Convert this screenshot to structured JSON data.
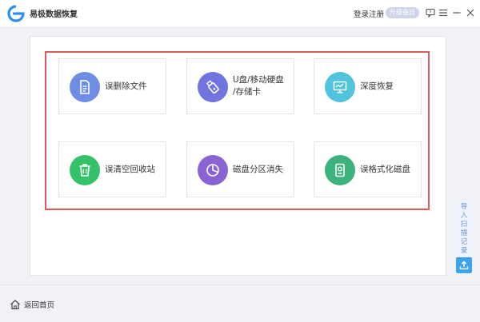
{
  "app": {
    "title": "易极数据恢复"
  },
  "header": {
    "login_label": "登录注册",
    "upgrade_label": "升级会员"
  },
  "icons": {
    "logo": "logo-icon",
    "feedback": "message-icon",
    "menu": "menu-icon",
    "minimize": "minimize-icon",
    "close": "close-icon"
  },
  "cards": [
    {
      "line1": "误删除文件",
      "line2": "",
      "icon": "document-icon",
      "color": "#6e8ee6"
    },
    {
      "line1": "U盘/移动硬盘",
      "line2": "/存储卡",
      "icon": "usb-drive-icon",
      "color": "#6f74df"
    },
    {
      "line1": "深度恢复",
      "line2": "",
      "icon": "monitor-icon",
      "color": "#4fc4dc"
    },
    {
      "line1": "误清空回收站",
      "line2": "",
      "icon": "trash-icon",
      "color": "#35c06a"
    },
    {
      "line1": "磁盘分区消失",
      "line2": "",
      "icon": "pie-chart-icon",
      "color": "#8a63d3"
    },
    {
      "line1": "误格式化磁盘",
      "line2": "",
      "icon": "hard-disk-icon",
      "color": "#3db27c"
    }
  ],
  "highlight_color": "#e05a5a",
  "side_button": {
    "chars": [
      "导",
      "入",
      "扫",
      "描",
      "记",
      "录"
    ],
    "icon": "upload-icon"
  },
  "footer": {
    "home_label": "返回首页",
    "icon": "home-icon"
  }
}
